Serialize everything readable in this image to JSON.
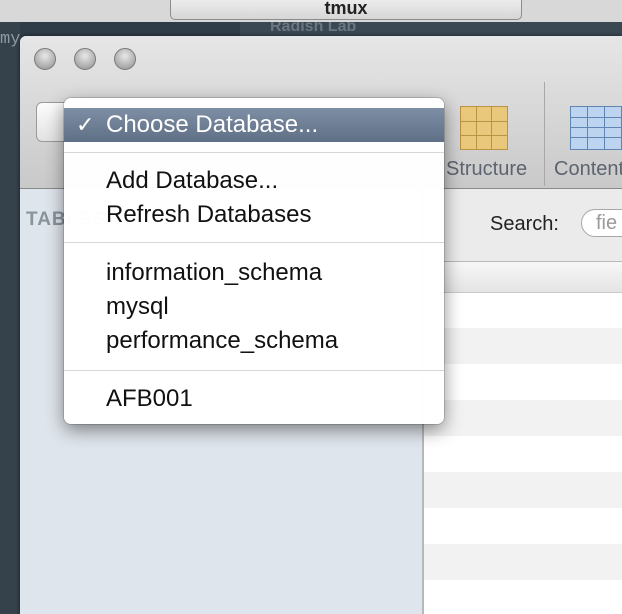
{
  "background": {
    "tab_title": "tmux",
    "terminal_text": "mys",
    "faded_title": "Radish Lab"
  },
  "toolbar": {
    "structure_label": "Structure",
    "content_label": "Content"
  },
  "sidebar": {
    "header": "TABLES"
  },
  "search": {
    "label": "Search:",
    "placeholder": "fie"
  },
  "menu": {
    "choose_database": "Choose Database...",
    "choose_check": "✓",
    "add_database": "Add Database...",
    "refresh_databases": "Refresh Databases",
    "databases": [
      "information_schema",
      "mysql",
      "performance_schema"
    ],
    "user_databases": [
      "AFB001"
    ]
  },
  "colors": {
    "menu_selected": "#6b7c93",
    "sidebar_bg": "#dfe5ec"
  }
}
